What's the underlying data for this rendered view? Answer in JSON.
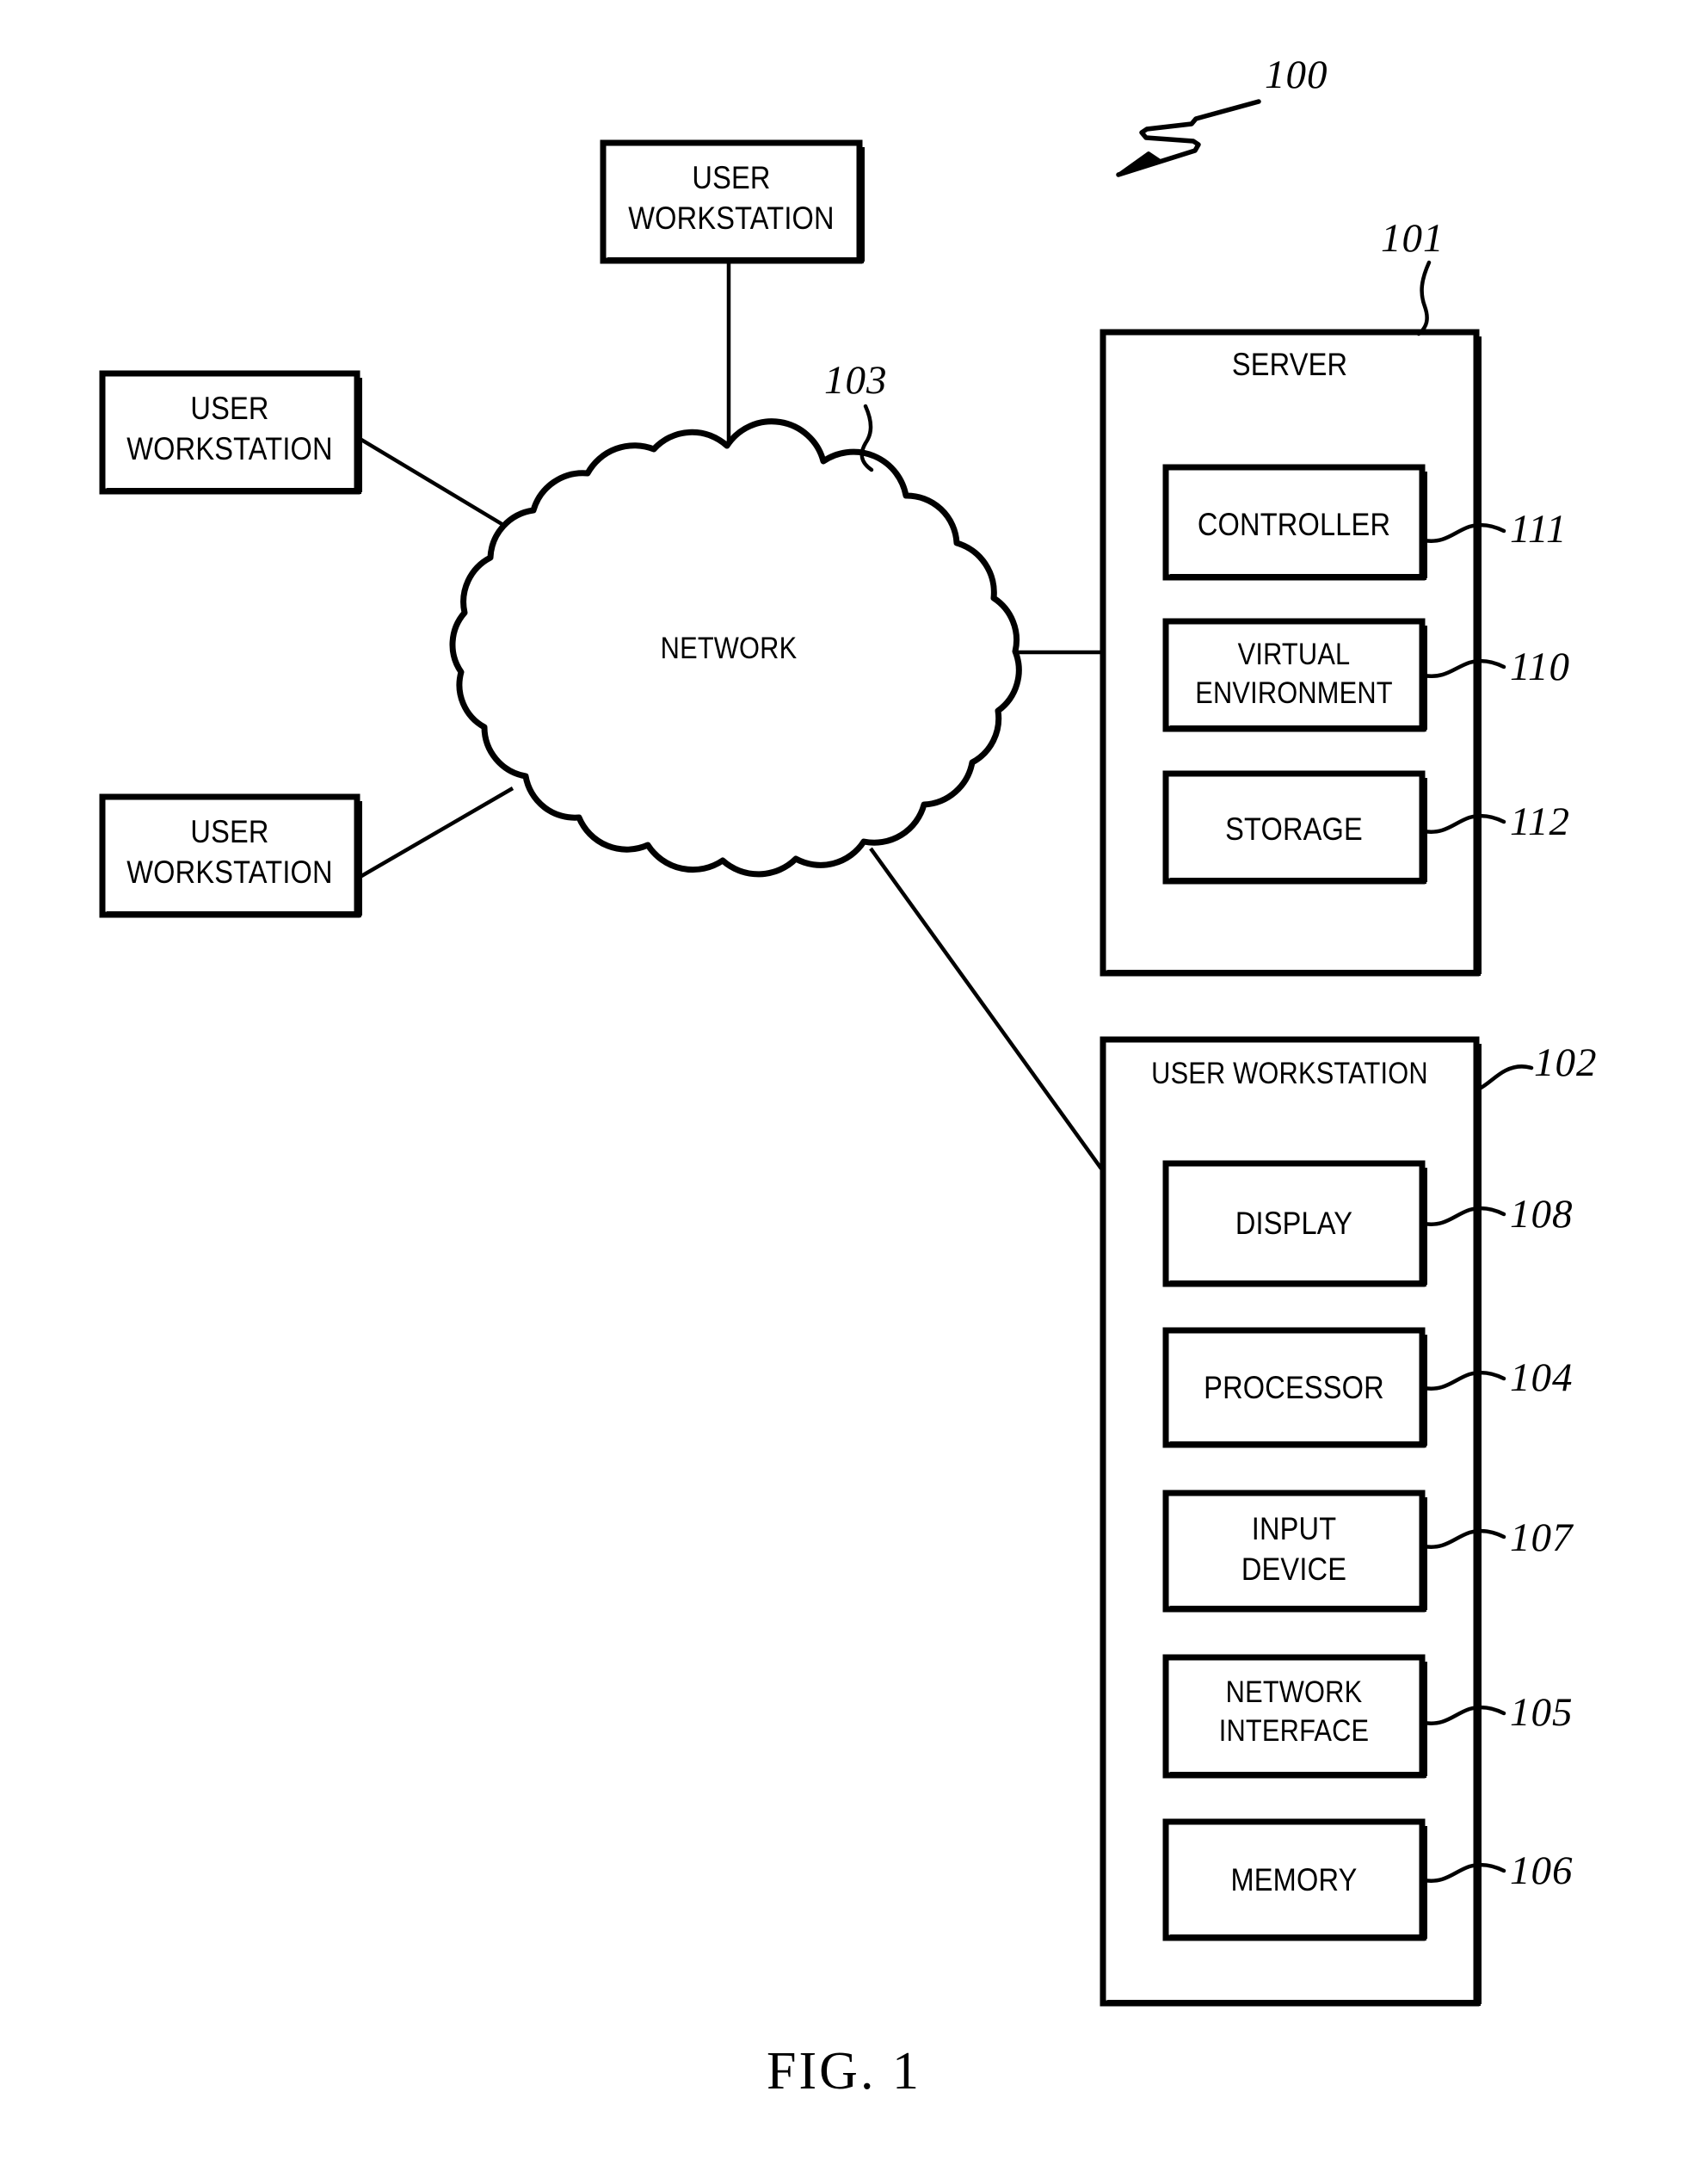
{
  "figure": {
    "caption": "FIG. 1",
    "system_ref": "100"
  },
  "nodes": {
    "workstation_top": {
      "line1": "USER",
      "line2": "WORKSTATION"
    },
    "workstation_left_upper": {
      "line1": "USER",
      "line2": "WORKSTATION"
    },
    "workstation_left_lower": {
      "line1": "USER",
      "line2": "WORKSTATION"
    },
    "network": {
      "label": "NETWORK",
      "ref": "103"
    },
    "server": {
      "title": "SERVER",
      "ref": "101",
      "components": [
        {
          "label": "CONTROLLER",
          "ref": "111"
        },
        {
          "line1": "VIRTUAL",
          "line2": "ENVIRONMENT",
          "ref": "110"
        },
        {
          "label": "STORAGE",
          "ref": "112"
        }
      ]
    },
    "user_workstation_detail": {
      "title": "USER WORKSTATION",
      "ref": "102",
      "components": [
        {
          "label": "DISPLAY",
          "ref": "108"
        },
        {
          "label": "PROCESSOR",
          "ref": "104"
        },
        {
          "line1": "INPUT",
          "line2": "DEVICE",
          "ref": "107"
        },
        {
          "line1": "NETWORK",
          "line2": "INTERFACE",
          "ref": "105"
        },
        {
          "label": "MEMORY",
          "ref": "106"
        }
      ]
    }
  },
  "style": {
    "ink": "#000000",
    "paper": "#ffffff"
  }
}
